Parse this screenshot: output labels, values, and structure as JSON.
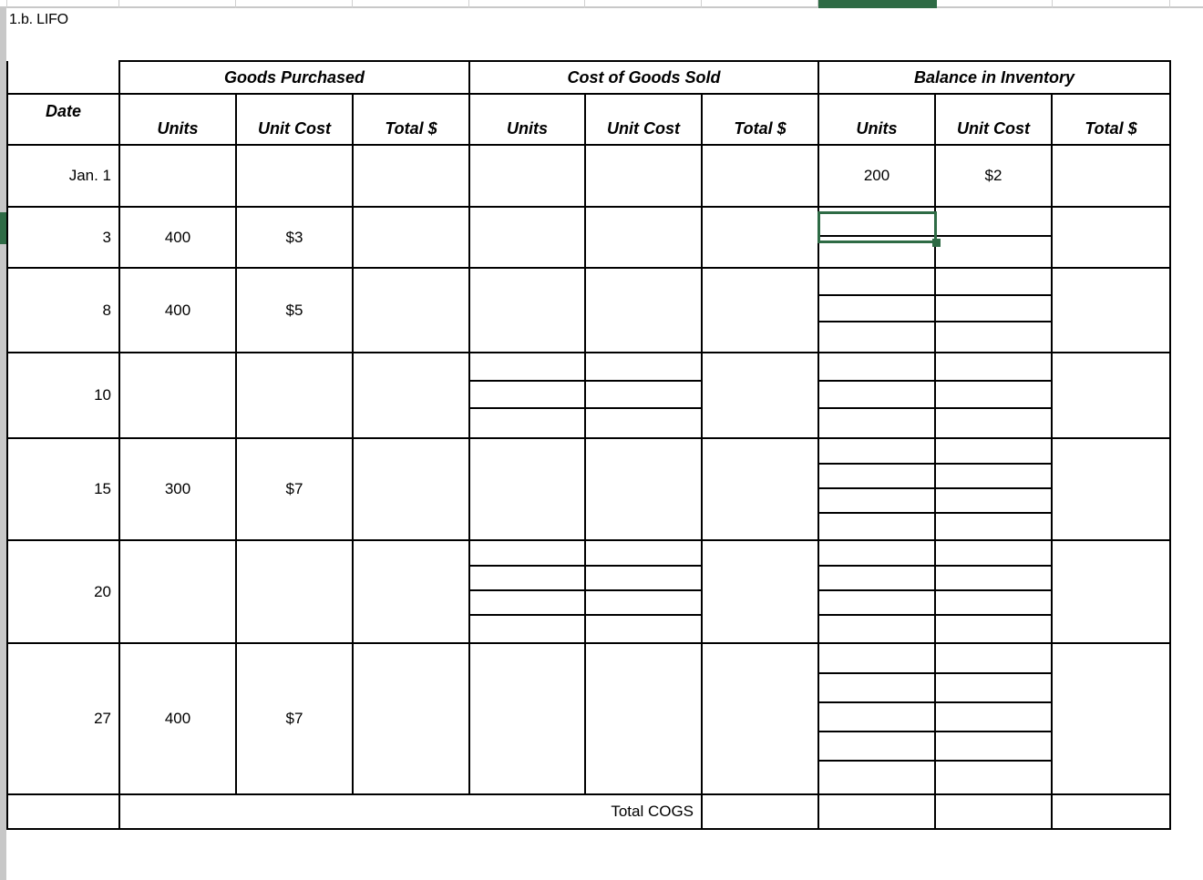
{
  "window": {
    "app_kind": "spreadsheet",
    "accent_color": "#2e6b45",
    "gridline_color": "#c8c8c8"
  },
  "sheet_title": "1.b. LIFO",
  "selection": {
    "active_cell_label": "",
    "column_header_highlight": true,
    "row_header_highlight": true
  },
  "table": {
    "group_headers": [
      {
        "label": "",
        "span": 1
      },
      {
        "label": "Goods Purchased",
        "span": 3
      },
      {
        "label": "Cost of Goods Sold",
        "span": 3
      },
      {
        "label": "Balance in Inventory",
        "span": 3
      }
    ],
    "column_headers": [
      "Date",
      "Units",
      "Unit Cost",
      "Total $",
      "Units",
      "Unit Cost",
      "Total $",
      "Units",
      "Unit Cost",
      "Total $"
    ],
    "rows": [
      {
        "date": "Jan. 1",
        "purchased": {
          "units": "",
          "unit_cost": "",
          "total": ""
        },
        "cogs": {
          "slots": 1,
          "units": [
            ""
          ],
          "unit_cost": [
            ""
          ],
          "total": ""
        },
        "balance": {
          "slots": 1,
          "units": [
            "200"
          ],
          "unit_cost": [
            "$2"
          ],
          "total": ""
        }
      },
      {
        "date": "3",
        "purchased": {
          "units": "400",
          "unit_cost": "$3",
          "total": ""
        },
        "cogs": {
          "slots": 1,
          "units": [
            ""
          ],
          "unit_cost": [
            ""
          ],
          "total": ""
        },
        "balance": {
          "slots": 2,
          "units": [
            "",
            ""
          ],
          "unit_cost": [
            "",
            ""
          ],
          "total": ""
        }
      },
      {
        "date": "8",
        "purchased": {
          "units": "400",
          "unit_cost": "$5",
          "total": ""
        },
        "cogs": {
          "slots": 1,
          "units": [
            ""
          ],
          "unit_cost": [
            ""
          ],
          "total": ""
        },
        "balance": {
          "slots": 3,
          "units": [
            "",
            "",
            ""
          ],
          "unit_cost": [
            "",
            "",
            ""
          ],
          "total": ""
        }
      },
      {
        "date": "10",
        "purchased": {
          "units": "",
          "unit_cost": "",
          "total": ""
        },
        "cogs": {
          "slots": 3,
          "units": [
            "",
            "",
            ""
          ],
          "unit_cost": [
            "",
            "",
            ""
          ],
          "total": ""
        },
        "balance": {
          "slots": 3,
          "units": [
            "",
            "",
            ""
          ],
          "unit_cost": [
            "",
            "",
            ""
          ],
          "total": ""
        }
      },
      {
        "date": "15",
        "purchased": {
          "units": "300",
          "unit_cost": "$7",
          "total": ""
        },
        "cogs": {
          "slots": 1,
          "units": [
            ""
          ],
          "unit_cost": [
            ""
          ],
          "total": ""
        },
        "balance": {
          "slots": 4,
          "units": [
            "",
            "",
            "",
            ""
          ],
          "unit_cost": [
            "",
            "",
            "",
            ""
          ],
          "total": ""
        }
      },
      {
        "date": "20",
        "purchased": {
          "units": "",
          "unit_cost": "",
          "total": ""
        },
        "cogs": {
          "slots": 4,
          "units": [
            "",
            "",
            "",
            ""
          ],
          "unit_cost": [
            "",
            "",
            "",
            ""
          ],
          "total": ""
        },
        "balance": {
          "slots": 4,
          "units": [
            "",
            "",
            "",
            ""
          ],
          "unit_cost": [
            "",
            "",
            "",
            ""
          ],
          "total": ""
        }
      },
      {
        "date": "27",
        "purchased": {
          "units": "400",
          "unit_cost": "$7",
          "total": ""
        },
        "cogs": {
          "slots": 1,
          "units": [
            ""
          ],
          "unit_cost": [
            ""
          ],
          "total": ""
        },
        "balance": {
          "slots": 5,
          "units": [
            "",
            "",
            "",
            "",
            ""
          ],
          "unit_cost": [
            "",
            "",
            "",
            "",
            ""
          ],
          "total": ""
        }
      }
    ],
    "footer": {
      "label": "Total COGS",
      "cogs_total": "",
      "balance_units": "",
      "balance_unit_cost": "",
      "balance_total": ""
    }
  }
}
